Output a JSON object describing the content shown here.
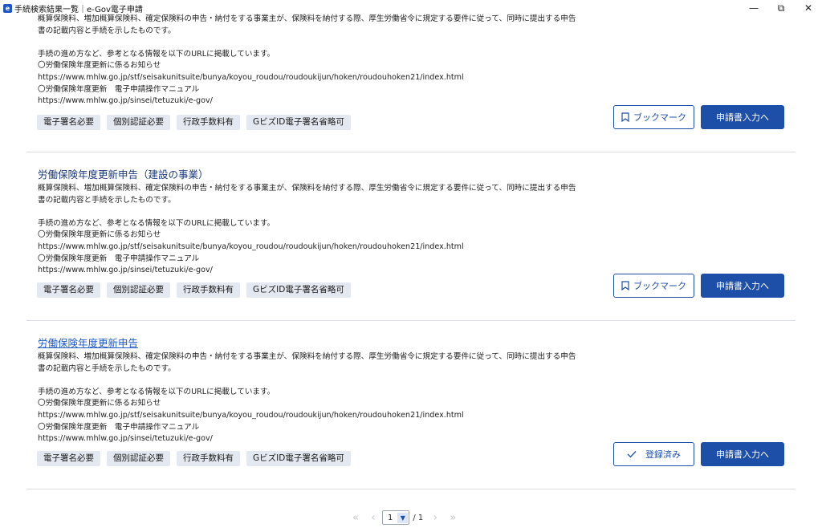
{
  "window": {
    "title": "手続検索結果一覧｜e-Gov電子申請",
    "app_icon": "e-gov-app-icon",
    "minimize": "—",
    "maximize": "⧉",
    "close": "✕"
  },
  "common": {
    "desc_line1": "概算保険料、増加概算保険料、確定保険料の申告・納付をする事業主が、保険料を納付する際、厚生労働省令に規定する要件に従って、同時に提出する申告",
    "desc_line2": "書の記載内容と手続を示したものです。",
    "info_intro": "手続の進め方など、参考となる情報を以下のURLに掲載しています。",
    "notice_label": "〇労働保険年度更新に係るお知らせ",
    "notice_url": "https://www.mhlw.go.jp/stf/seisakunitsuite/bunya/koyou_roudou/roudoukijun/hoken/roudouhoken21/index.html",
    "manual_label": "〇労働保険年度更新　電子申請操作マニュアル",
    "manual_url": "https://www.mhlw.go.jp/sinsei/tetuzuki/e-gov/",
    "tags": [
      "電子署名必要",
      "個別認証必要",
      "行政手数料有",
      "GビズID電子署名省略可"
    ],
    "apply_button": "申請書入力へ"
  },
  "items": [
    {
      "title": "",
      "action_button": "ブックマーク",
      "action_icon": "bookmark-icon"
    },
    {
      "title": "労働保険年度更新申告（建設の事業）",
      "action_button": "ブックマーク",
      "action_icon": "bookmark-icon"
    },
    {
      "title": "労働保険年度更新申告",
      "action_button": "登録済み",
      "action_icon": "check-icon"
    }
  ],
  "pager": {
    "first": "«",
    "prev": "‹",
    "current": "1",
    "total": "/ 1",
    "next": "›",
    "last": "»"
  }
}
